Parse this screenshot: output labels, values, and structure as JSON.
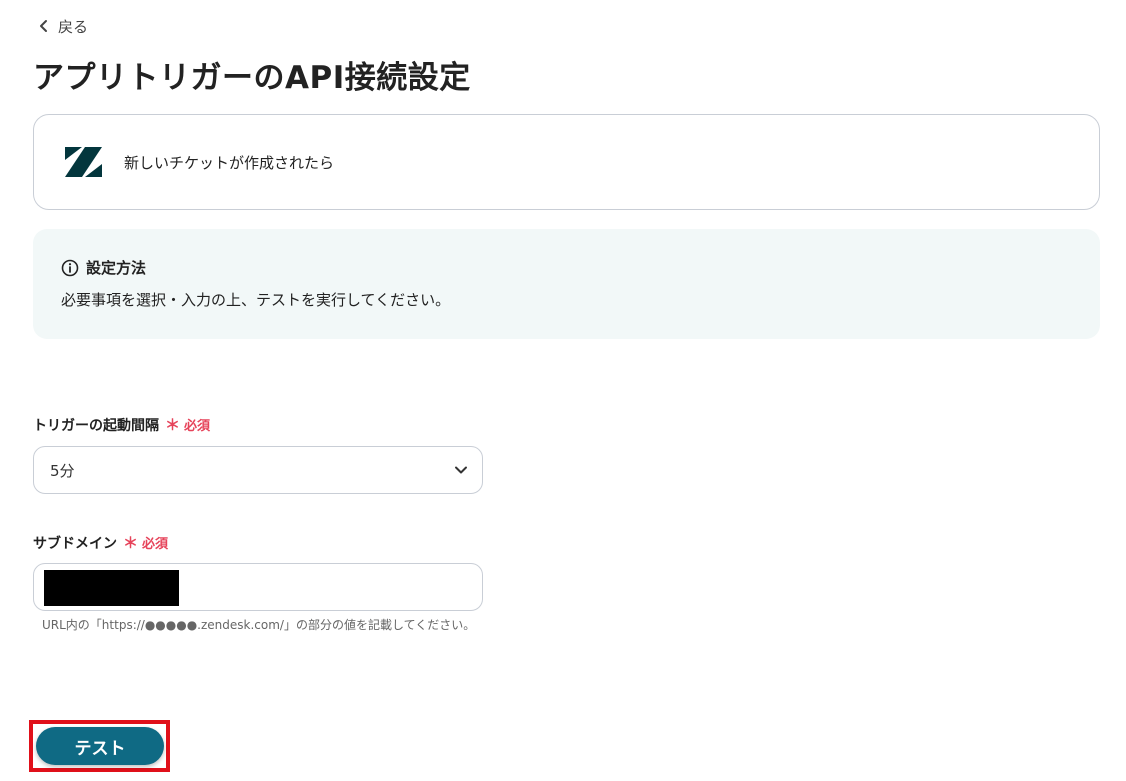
{
  "nav": {
    "back_label": "戻る",
    "back_icon": "chevron-left-icon"
  },
  "header": {
    "title": "アプリトリガーのAPI接続設定"
  },
  "trigger": {
    "app_icon": "zendesk-logo",
    "name": "新しいチケットが作成されたら"
  },
  "info": {
    "icon": "info-circle-icon",
    "title": "設定方法",
    "body": "必要事項を選択・入力の上、テストを実行してください。"
  },
  "form": {
    "interval": {
      "label": "トリガーの起動間隔",
      "required_mark": "＊",
      "required_text": "必須",
      "value": "5分",
      "icon": "chevron-down-icon"
    },
    "subdomain": {
      "label": "サブドメイン",
      "required_mark": "＊",
      "required_text": "必須",
      "value": "",
      "help": "URL内の「https://●●●●●.zendesk.com/」の部分の値を記載してください。"
    }
  },
  "actions": {
    "test_label": "テスト"
  },
  "colors": {
    "primary": "#0f6a84",
    "required": "#e6435a",
    "info_bg": "#f2f8f8",
    "border": "#c9ced6",
    "highlight": "#e0101a",
    "logo": "#03363d"
  }
}
